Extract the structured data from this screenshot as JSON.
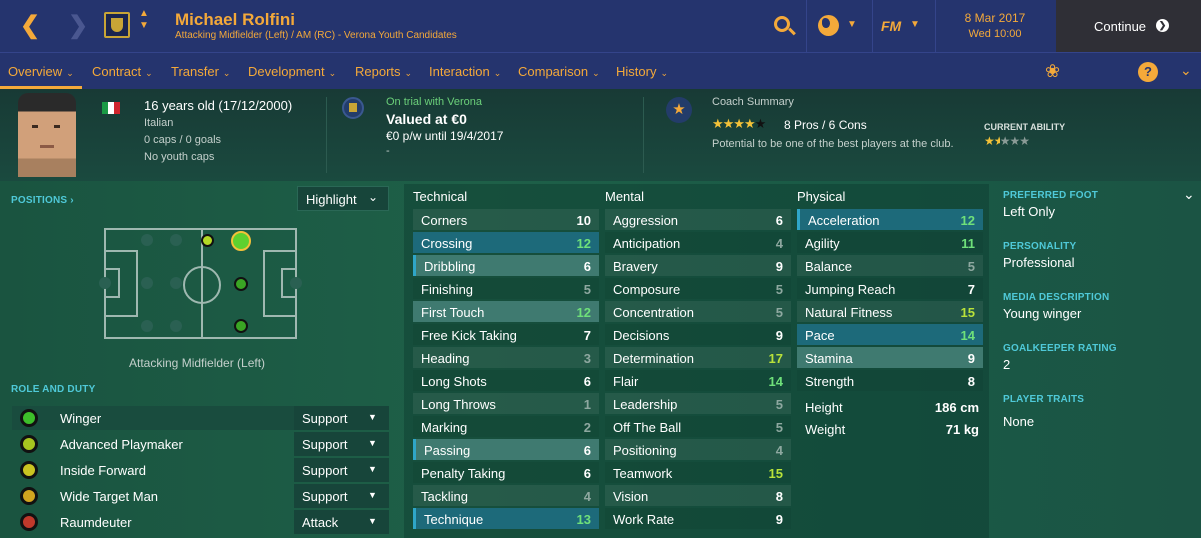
{
  "header": {
    "player_name": "Michael Rolfini",
    "subtitle": "Attacking Midfielder (Left) / AM (RC) - Verona Youth Candidates",
    "fm_logo": "FM",
    "date": "8 Mar 2017",
    "time": "Wed 10:00",
    "continue_label": "Continue"
  },
  "nav": {
    "items": [
      "Overview",
      "Contract",
      "Transfer",
      "Development",
      "Reports",
      "Interaction",
      "Comparison",
      "History"
    ],
    "help": "?"
  },
  "info": {
    "age": "16 years old (17/12/2000)",
    "nationality": "Italian",
    "caps": "0 caps / 0 goals",
    "youth_caps": "No youth caps",
    "trial": "On trial with Verona",
    "value": "Valued at €0",
    "wage": "€0 p/w until 19/4/2017",
    "dash": "-",
    "coach_title": "Coach Summary",
    "pros_cons": "8 Pros / 6 Cons",
    "coach_stars": 4,
    "potential_text": "Potential to be one of the best players at the club.",
    "current_ability_label": "CURRENT ABILITY",
    "current_ability_stars": 1.5
  },
  "positions": {
    "label": "POSITIONS",
    "highlight": "Highlight",
    "position_name": "Attacking Midfielder (Left)"
  },
  "roles": {
    "label": "ROLE AND DUTY",
    "items": [
      {
        "name": "Winger",
        "duty": "Support",
        "color": "#3dbe2a"
      },
      {
        "name": "Advanced Playmaker",
        "duty": "Support",
        "color": "#a7c51f"
      },
      {
        "name": "Inside Forward",
        "duty": "Support",
        "color": "#c9c421"
      },
      {
        "name": "Wide Target Man",
        "duty": "Support",
        "color": "#d1a51f"
      },
      {
        "name": "Raumdeuter",
        "duty": "Attack",
        "color": "#c0392b"
      }
    ]
  },
  "attributes": {
    "technical_label": "Technical",
    "mental_label": "Mental",
    "physical_label": "Physical",
    "technical": [
      {
        "name": "Corners",
        "value": "10"
      },
      {
        "name": "Crossing",
        "value": "12"
      },
      {
        "name": "Dribbling",
        "value": "6"
      },
      {
        "name": "Finishing",
        "value": "5"
      },
      {
        "name": "First Touch",
        "value": "12"
      },
      {
        "name": "Free Kick Taking",
        "value": "7"
      },
      {
        "name": "Heading",
        "value": "3"
      },
      {
        "name": "Long Shots",
        "value": "6"
      },
      {
        "name": "Long Throws",
        "value": "1"
      },
      {
        "name": "Marking",
        "value": "2"
      },
      {
        "name": "Passing",
        "value": "6"
      },
      {
        "name": "Penalty Taking",
        "value": "6"
      },
      {
        "name": "Tackling",
        "value": "4"
      },
      {
        "name": "Technique",
        "value": "13"
      }
    ],
    "mental": [
      {
        "name": "Aggression",
        "value": "6"
      },
      {
        "name": "Anticipation",
        "value": "4"
      },
      {
        "name": "Bravery",
        "value": "9"
      },
      {
        "name": "Composure",
        "value": "5"
      },
      {
        "name": "Concentration",
        "value": "5"
      },
      {
        "name": "Decisions",
        "value": "9"
      },
      {
        "name": "Determination",
        "value": "17"
      },
      {
        "name": "Flair",
        "value": "14"
      },
      {
        "name": "Leadership",
        "value": "5"
      },
      {
        "name": "Off The Ball",
        "value": "5"
      },
      {
        "name": "Positioning",
        "value": "4"
      },
      {
        "name": "Teamwork",
        "value": "15"
      },
      {
        "name": "Vision",
        "value": "8"
      },
      {
        "name": "Work Rate",
        "value": "9"
      }
    ],
    "physical": [
      {
        "name": "Acceleration",
        "value": "12"
      },
      {
        "name": "Agility",
        "value": "11"
      },
      {
        "name": "Balance",
        "value": "5"
      },
      {
        "name": "Jumping Reach",
        "value": "7"
      },
      {
        "name": "Natural Fitness",
        "value": "15"
      },
      {
        "name": "Pace",
        "value": "14"
      },
      {
        "name": "Stamina",
        "value": "9"
      },
      {
        "name": "Strength",
        "value": "8"
      }
    ],
    "height_label": "Height",
    "height": "186 cm",
    "weight_label": "Weight",
    "weight": "71 kg"
  },
  "details": {
    "preferred_foot_label": "PREFERRED FOOT",
    "preferred_foot": "Left Only",
    "personality_label": "PERSONALITY",
    "personality": "Professional",
    "media_label": "MEDIA DESCRIPTION",
    "media": "Young winger",
    "gk_label": "GOALKEEPER RATING",
    "gk": "2",
    "traits_label": "PLAYER TRAITS",
    "traits": "None"
  }
}
